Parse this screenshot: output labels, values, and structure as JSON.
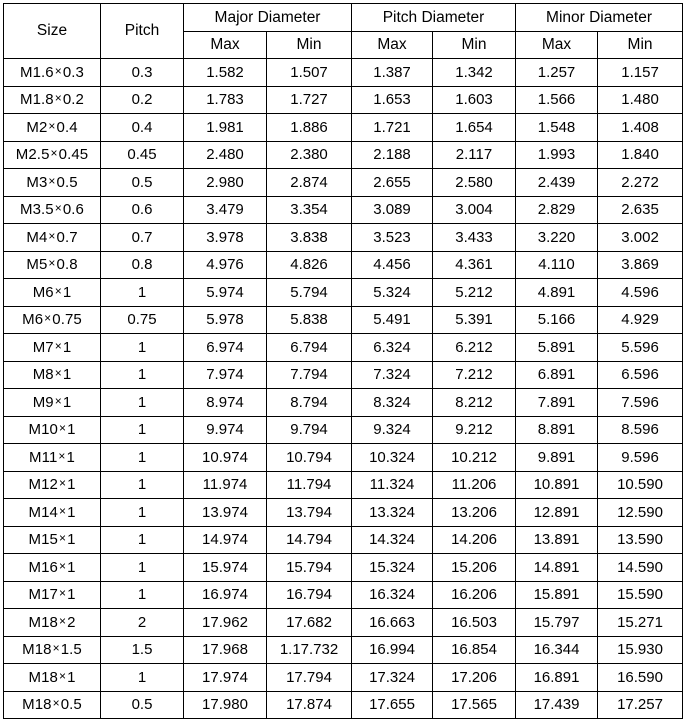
{
  "table": {
    "name": "metric-thread-dimensions",
    "header": {
      "size_label": "Size",
      "pitch_label": "Pitch",
      "groups": [
        {
          "label": "Major Diameter"
        },
        {
          "label": "Pitch Diameter"
        },
        {
          "label": "Minor Diameter"
        }
      ],
      "sub": {
        "max_label": "Max",
        "min_label": "Min"
      }
    },
    "columns": [
      "Size",
      "Pitch",
      "Major Diameter Max",
      "Major Diameter Min",
      "Pitch Diameter Max",
      "Pitch Diameter Min",
      "Minor Diameter Max",
      "Minor Diameter Min"
    ],
    "rows": [
      {
        "size_prefix": "M1.6",
        "size_suffix": "0.3",
        "pitch": "0.3",
        "major_max": "1.582",
        "major_min": "1.507",
        "pitch_max": "1.387",
        "pitch_min": "1.342",
        "minor_max": "1.257",
        "minor_min": "1.157"
      },
      {
        "size_prefix": "M1.8",
        "size_suffix": "0.2",
        "pitch": "0.2",
        "major_max": "1.783",
        "major_min": "1.727",
        "pitch_max": "1.653",
        "pitch_min": "1.603",
        "minor_max": "1.566",
        "minor_min": "1.480"
      },
      {
        "size_prefix": "M2",
        "size_suffix": "0.4",
        "pitch": "0.4",
        "major_max": "1.981",
        "major_min": "1.886",
        "pitch_max": "1.721",
        "pitch_min": "1.654",
        "minor_max": "1.548",
        "minor_min": "1.408"
      },
      {
        "size_prefix": "M2.5",
        "size_suffix": "0.45",
        "pitch": "0.45",
        "major_max": "2.480",
        "major_min": "2.380",
        "pitch_max": "2.188",
        "pitch_min": "2.117",
        "minor_max": "1.993",
        "minor_min": "1.840"
      },
      {
        "size_prefix": "M3",
        "size_suffix": "0.5",
        "pitch": "0.5",
        "major_max": "2.980",
        "major_min": "2.874",
        "pitch_max": "2.655",
        "pitch_min": "2.580",
        "minor_max": "2.439",
        "minor_min": "2.272"
      },
      {
        "size_prefix": "M3.5",
        "size_suffix": "0.6",
        "pitch": "0.6",
        "major_max": "3.479",
        "major_min": "3.354",
        "pitch_max": "3.089",
        "pitch_min": "3.004",
        "minor_max": "2.829",
        "minor_min": "2.635"
      },
      {
        "size_prefix": "M4",
        "size_suffix": "0.7",
        "pitch": "0.7",
        "major_max": "3.978",
        "major_min": "3.838",
        "pitch_max": "3.523",
        "pitch_min": "3.433",
        "minor_max": "3.220",
        "minor_min": "3.002"
      },
      {
        "size_prefix": "M5",
        "size_suffix": "0.8",
        "pitch": "0.8",
        "major_max": "4.976",
        "major_min": "4.826",
        "pitch_max": "4.456",
        "pitch_min": "4.361",
        "minor_max": "4.110",
        "minor_min": "3.869"
      },
      {
        "size_prefix": "M6",
        "size_suffix": "1",
        "pitch": "1",
        "major_max": "5.974",
        "major_min": "5.794",
        "pitch_max": "5.324",
        "pitch_min": "5.212",
        "minor_max": "4.891",
        "minor_min": "4.596"
      },
      {
        "size_prefix": "M6",
        "size_suffix": "0.75",
        "pitch": "0.75",
        "major_max": "5.978",
        "major_min": "5.838",
        "pitch_max": "5.491",
        "pitch_min": "5.391",
        "minor_max": "5.166",
        "minor_min": "4.929"
      },
      {
        "size_prefix": "M7",
        "size_suffix": "1",
        "pitch": "1",
        "major_max": "6.974",
        "major_min": "6.794",
        "pitch_max": "6.324",
        "pitch_min": "6.212",
        "minor_max": "5.891",
        "minor_min": "5.596"
      },
      {
        "size_prefix": "M8",
        "size_suffix": "1",
        "pitch": "1",
        "major_max": "7.974",
        "major_min": "7.794",
        "pitch_max": "7.324",
        "pitch_min": "7.212",
        "minor_max": "6.891",
        "minor_min": "6.596"
      },
      {
        "size_prefix": "M9",
        "size_suffix": "1",
        "pitch": "1",
        "major_max": "8.974",
        "major_min": "8.794",
        "pitch_max": "8.324",
        "pitch_min": "8.212",
        "minor_max": "7.891",
        "minor_min": "7.596"
      },
      {
        "size_prefix": "M10",
        "size_suffix": "1",
        "pitch": "1",
        "major_max": "9.974",
        "major_min": "9.794",
        "pitch_max": "9.324",
        "pitch_min": "9.212",
        "minor_max": "8.891",
        "minor_min": "8.596"
      },
      {
        "size_prefix": "M11",
        "size_suffix": "1",
        "pitch": "1",
        "major_max": "10.974",
        "major_min": "10.794",
        "pitch_max": "10.324",
        "pitch_min": "10.212",
        "minor_max": "9.891",
        "minor_min": "9.596"
      },
      {
        "size_prefix": "M12",
        "size_suffix": "1",
        "pitch": "1",
        "major_max": "11.974",
        "major_min": "11.794",
        "pitch_max": "11.324",
        "pitch_min": "11.206",
        "minor_max": "10.891",
        "minor_min": "10.590"
      },
      {
        "size_prefix": "M14",
        "size_suffix": "1",
        "pitch": "1",
        "major_max": "13.974",
        "major_min": "13.794",
        "pitch_max": "13.324",
        "pitch_min": "13.206",
        "minor_max": "12.891",
        "minor_min": "12.590"
      },
      {
        "size_prefix": "M15",
        "size_suffix": "1",
        "pitch": "1",
        "major_max": "14.974",
        "major_min": "14.794",
        "pitch_max": "14.324",
        "pitch_min": "14.206",
        "minor_max": "13.891",
        "minor_min": "13.590"
      },
      {
        "size_prefix": "M16",
        "size_suffix": "1",
        "pitch": "1",
        "major_max": "15.974",
        "major_min": "15.794",
        "pitch_max": "15.324",
        "pitch_min": "15.206",
        "minor_max": "14.891",
        "minor_min": "14.590"
      },
      {
        "size_prefix": "M17",
        "size_suffix": "1",
        "pitch": "1",
        "major_max": "16.974",
        "major_min": "16.794",
        "pitch_max": "16.324",
        "pitch_min": "16.206",
        "minor_max": "15.891",
        "minor_min": "15.590"
      },
      {
        "size_prefix": "M18",
        "size_suffix": "2",
        "pitch": "2",
        "major_max": "17.962",
        "major_min": "17.682",
        "pitch_max": "16.663",
        "pitch_min": "16.503",
        "minor_max": "15.797",
        "minor_min": "15.271"
      },
      {
        "size_prefix": "M18",
        "size_suffix": "1.5",
        "pitch": "1.5",
        "major_max": "17.968",
        "major_min": "1.17.732",
        "pitch_max": "16.994",
        "pitch_min": "16.854",
        "minor_max": "16.344",
        "minor_min": "15.930"
      },
      {
        "size_prefix": "M18",
        "size_suffix": "1",
        "pitch": "1",
        "major_max": "17.974",
        "major_min": "17.794",
        "pitch_max": "17.324",
        "pitch_min": "17.206",
        "minor_max": "16.891",
        "minor_min": "16.590"
      },
      {
        "size_prefix": "M18",
        "size_suffix": "0.5",
        "pitch": "0.5",
        "major_max": "17.980",
        "major_min": "17.874",
        "pitch_max": "17.655",
        "pitch_min": "17.565",
        "minor_max": "17.439",
        "minor_min": "17.257"
      }
    ],
    "symbols": {
      "multiply": "×"
    },
    "colors": {
      "border": "#000000",
      "text": "#000000",
      "background": "#ffffff"
    }
  }
}
